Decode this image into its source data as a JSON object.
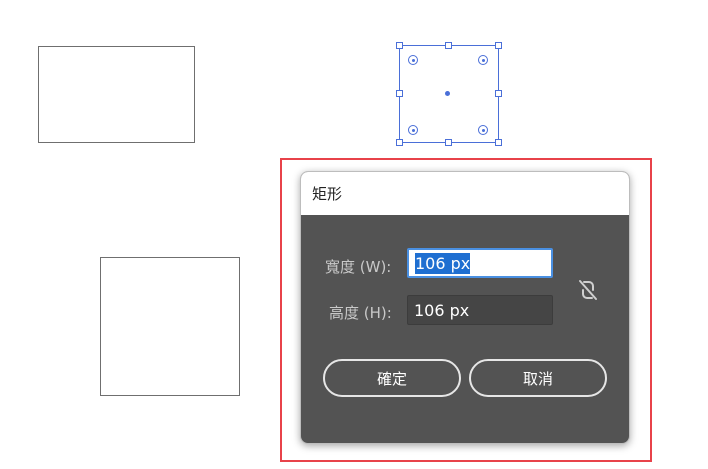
{
  "dialog": {
    "title": "矩形",
    "width_label": "寬度 (W):",
    "width_value": "106 px",
    "height_label": "高度 (H):",
    "height_value": "106 px",
    "constrain_icon": "unlink-icon",
    "ok_label": "確定",
    "cancel_label": "取消"
  },
  "colors": {
    "selection": "#4a6fd8",
    "highlight": "#e8424a",
    "dialog_bg": "#535353"
  }
}
